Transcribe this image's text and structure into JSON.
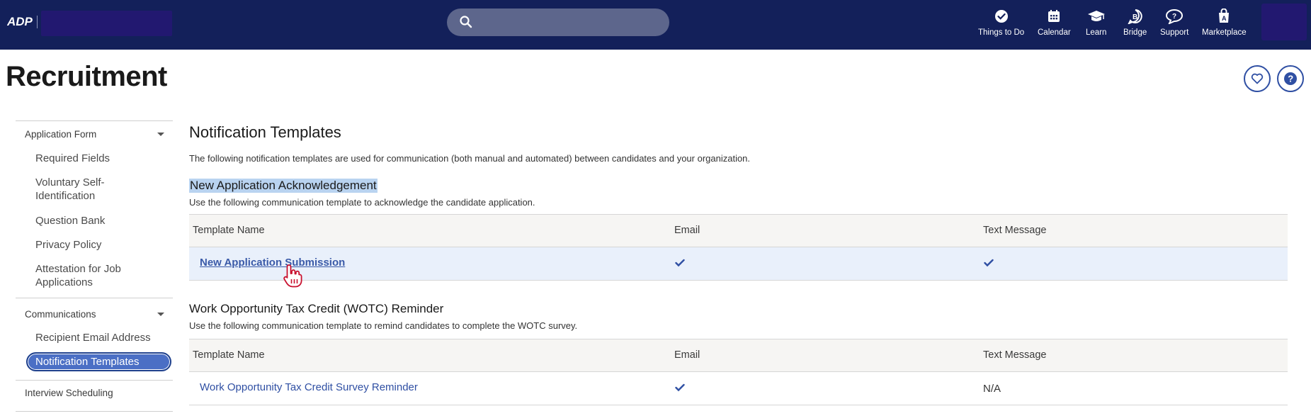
{
  "header": {
    "nav": [
      {
        "label": "Things to Do",
        "icon": "check-circle-icon"
      },
      {
        "label": "Calendar",
        "icon": "calendar-icon"
      },
      {
        "label": "Learn",
        "icon": "graduation-cap-icon"
      },
      {
        "label": "Bridge",
        "icon": "bridge-icon"
      },
      {
        "label": "Support",
        "icon": "support-chat-icon"
      },
      {
        "label": "Marketplace",
        "icon": "marketplace-icon"
      }
    ],
    "colors": {
      "bar": "#13205a",
      "search": "#5d668c"
    }
  },
  "page": {
    "title": "Recruitment"
  },
  "sidebar": {
    "groups": [
      {
        "label": "Application Form",
        "items": [
          "Required Fields",
          "Voluntary Self-\nIdentification",
          "Question Bank",
          "Privacy Policy",
          "Attestation for Job\nApplications"
        ]
      },
      {
        "label": "Communications",
        "items": [
          "Recipient Email Address",
          "Notification Templates"
        ]
      },
      {
        "label": "Interview Scheduling",
        "items": []
      }
    ],
    "active_item": "Notification Templates"
  },
  "main": {
    "title": "Notification Templates",
    "intro": "The following notification templates are used for communication (both manual and automated) between candidates and your organization.",
    "sections": [
      {
        "title": "New Application Acknowledgement",
        "description": "Use the following communication template to acknowledge the candidate application.",
        "columns": [
          "Template Name",
          "Email",
          "Text Message"
        ],
        "rows": [
          {
            "name": "New Application Submission",
            "email": "check",
            "text": "check"
          }
        ]
      },
      {
        "title": "Work Opportunity Tax Credit (WOTC) Reminder",
        "description": "Use the following communication template to remind candidates to complete the WOTC survey.",
        "columns": [
          "Template Name",
          "Email",
          "Text Message"
        ],
        "rows": [
          {
            "name": "Work Opportunity Tax Credit Survey Reminder",
            "email": "check",
            "text": "N/A"
          }
        ]
      }
    ]
  }
}
